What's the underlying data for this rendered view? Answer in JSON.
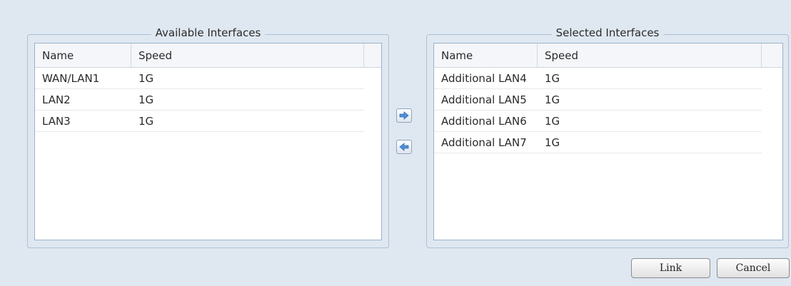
{
  "available": {
    "title": "Available Interfaces",
    "columns": [
      "Name",
      "Speed"
    ],
    "rows": [
      {
        "name": "WAN/LAN1",
        "speed": "1G"
      },
      {
        "name": "LAN2",
        "speed": "1G"
      },
      {
        "name": "LAN3",
        "speed": "1G"
      }
    ]
  },
  "selected": {
    "title": "Selected Interfaces",
    "columns": [
      "Name",
      "Speed"
    ],
    "rows": [
      {
        "name": "Additional LAN4",
        "speed": "1G"
      },
      {
        "name": "Additional LAN5",
        "speed": "1G"
      },
      {
        "name": "Additional LAN6",
        "speed": "1G"
      },
      {
        "name": "Additional LAN7",
        "speed": "1G"
      }
    ]
  },
  "transfer": {
    "add_icon": "arrow-right-icon",
    "remove_icon": "arrow-left-icon"
  },
  "buttons": {
    "link_label": "Link",
    "cancel_label": "Cancel"
  },
  "colors": {
    "background": "#dfe8f1",
    "border": "#aec1d6",
    "arrow": "#4f8fd6"
  }
}
